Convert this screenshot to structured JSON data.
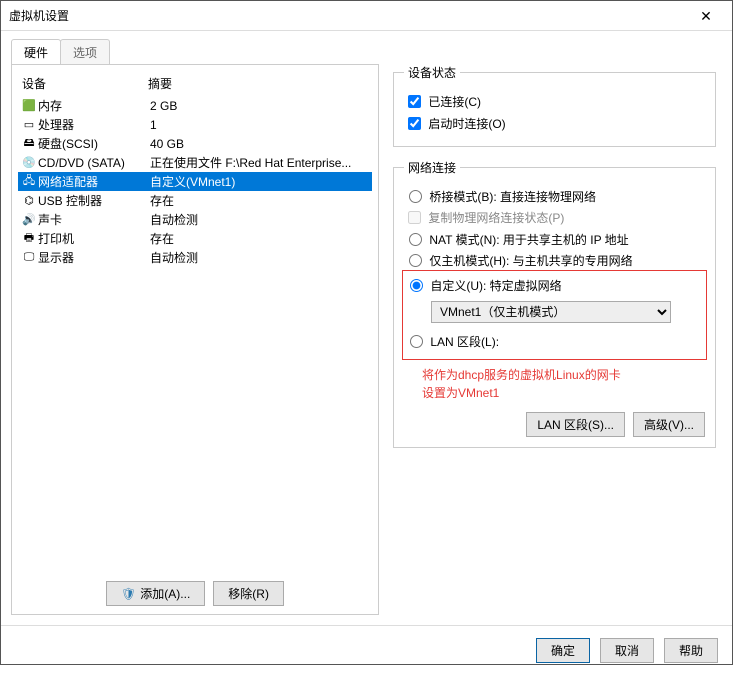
{
  "window": {
    "title": "虚拟机设置"
  },
  "tabs": {
    "hardware": "硬件",
    "options": "选项"
  },
  "list": {
    "header_device": "设备",
    "header_summary": "摘要",
    "rows": [
      {
        "icon": "🟩",
        "device": "内存",
        "summary": "2 GB"
      },
      {
        "icon": "▭",
        "device": "处理器",
        "summary": "1"
      },
      {
        "icon": "🖴",
        "device": "硬盘(SCSI)",
        "summary": "40 GB"
      },
      {
        "icon": "💿",
        "device": "CD/DVD (SATA)",
        "summary": "正在使用文件 F:\\Red Hat Enterprise..."
      },
      {
        "icon": "🖧",
        "device": "网络适配器",
        "summary": "自定义(VMnet1)"
      },
      {
        "icon": "⌬",
        "device": "USB 控制器",
        "summary": "存在"
      },
      {
        "icon": "🔊",
        "device": "声卡",
        "summary": "自动检测"
      },
      {
        "icon": "🖶",
        "device": "打印机",
        "summary": "存在"
      },
      {
        "icon": "🖵",
        "device": "显示器",
        "summary": "自动检测"
      }
    ],
    "selected_index": 4,
    "add_label": "添加(A)...",
    "remove_label": "移除(R)"
  },
  "device_state": {
    "legend": "设备状态",
    "connected": "已连接(C)",
    "connect_at_poweron": "启动时连接(O)"
  },
  "netconn": {
    "legend": "网络连接",
    "bridged": "桥接模式(B): 直接连接物理网络",
    "replicate": "复制物理网络连接状态(P)",
    "nat": "NAT 模式(N): 用于共享主机的 IP 地址",
    "hostonly": "仅主机模式(H): 与主机共享的专用网络",
    "custom": "自定义(U): 特定虚拟网络",
    "custom_option": "VMnet1（仅主机模式）",
    "lanseg": "LAN 区段(L):"
  },
  "annotation": {
    "line1": "将作为dhcp服务的虚拟机Linux的网卡",
    "line2": "设置为VMnet1"
  },
  "right_buttons": {
    "lanseg": "LAN 区段(S)...",
    "advanced": "高级(V)..."
  },
  "bottom": {
    "ok": "确定",
    "cancel": "取消",
    "help": "帮助"
  }
}
